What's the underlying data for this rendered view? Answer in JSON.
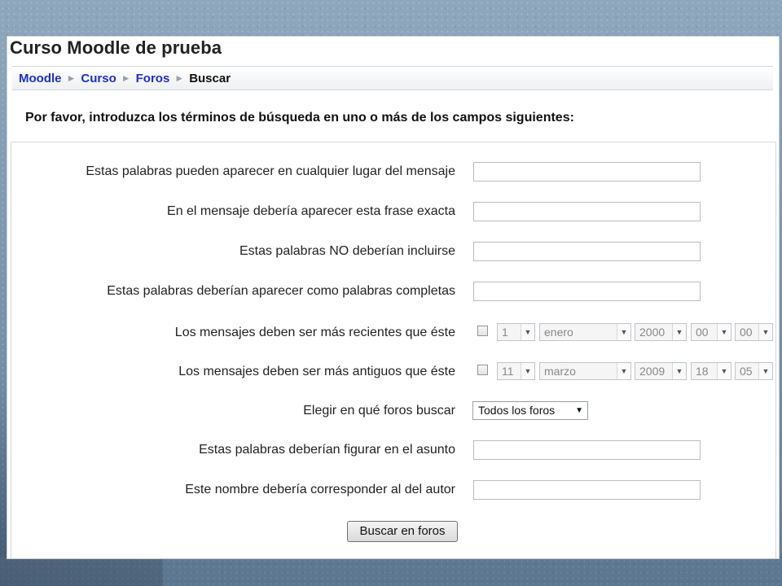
{
  "course_title": "Curso Moodle de prueba",
  "breadcrumb": {
    "items": [
      "Moodle",
      "Curso",
      "Foros"
    ],
    "current": "Buscar",
    "separator": "►"
  },
  "intro": "Por favor, introduzca los términos de búsqueda en uno o más de los campos siguientes:",
  "fields": {
    "words_anywhere": {
      "label": "Estas palabras pueden aparecer en cualquier lugar del mensaje",
      "value": ""
    },
    "exact_phrase": {
      "label": "En el mensaje debería aparecer esta frase exacta",
      "value": ""
    },
    "exclude_words": {
      "label": "Estas palabras NO deberían incluirse",
      "value": ""
    },
    "whole_words": {
      "label": "Estas palabras deberían aparecer como palabras completas",
      "value": ""
    },
    "date_from": {
      "label": "Los mensajes deben ser más recientes que éste",
      "enabled": false,
      "day": "1",
      "month": "enero",
      "year": "2000",
      "hour": "00",
      "minute": "00"
    },
    "date_to": {
      "label": "Los mensajes deben ser más antiguos que éste",
      "enabled": false,
      "day": "11",
      "month": "marzo",
      "year": "2009",
      "hour": "18",
      "minute": "05"
    },
    "forum_select": {
      "label": "Elegir en qué foros buscar",
      "value": "Todos los foros"
    },
    "subject_words": {
      "label": "Estas palabras deberían figurar en el asunto",
      "value": ""
    },
    "author_name": {
      "label": "Este nombre debería corresponder al del autor",
      "value": ""
    }
  },
  "submit_label": "Buscar en foros",
  "icons": {
    "dropdown": "chevron-down-icon",
    "breadcrumb_separator": "triangle-right-icon"
  },
  "colors": {
    "link": "#1c2fcd",
    "background": "#7e98b0"
  }
}
